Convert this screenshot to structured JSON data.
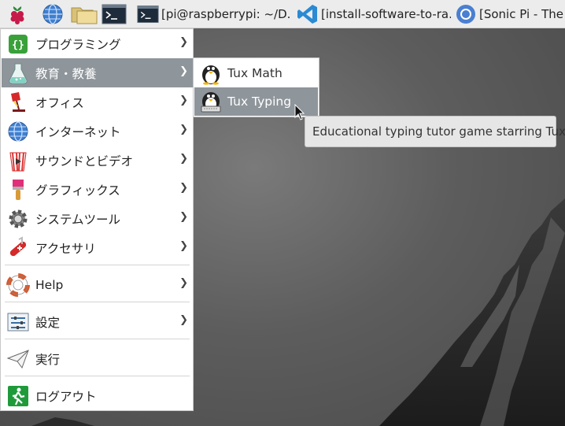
{
  "taskbar": {
    "tasks": [
      {
        "label": "[pi@raspberrypi: ~/D...",
        "icon": "terminal-icon"
      },
      {
        "label": "[install-software-to-ra...",
        "icon": "vscode-icon"
      },
      {
        "label": "[Sonic Pi - The L",
        "icon": "chromium-icon"
      }
    ]
  },
  "menu": {
    "items": [
      {
        "label": "プログラミング",
        "icon": "programming-icon"
      },
      {
        "label": "教育・教養",
        "icon": "education-flask-icon"
      },
      {
        "label": "オフィス",
        "icon": "office-lamp-icon"
      },
      {
        "label": "インターネット",
        "icon": "globe-icon"
      },
      {
        "label": "サウンドとビデオ",
        "icon": "popcorn-icon"
      },
      {
        "label": "グラフィックス",
        "icon": "paintbrush-icon"
      },
      {
        "label": "システムツール",
        "icon": "gear-icon"
      },
      {
        "label": "アクセサリ",
        "icon": "swiss-knife-icon"
      },
      {
        "label": "Help",
        "icon": "lifebuoy-icon"
      },
      {
        "label": "設定",
        "icon": "settings-sliders-icon"
      },
      {
        "label": "実行",
        "icon": "paper-plane-icon"
      },
      {
        "label": "ログアウト",
        "icon": "exit-icon"
      }
    ]
  },
  "submenu": {
    "items": [
      {
        "label": "Tux Math",
        "icon": "tux-math-icon"
      },
      {
        "label": "Tux Typing",
        "icon": "tux-typing-icon"
      }
    ]
  },
  "tooltip": "Educational typing tutor game starring Tux",
  "colors": {
    "highlight": "#8e959b",
    "taskbar": "#ececec",
    "menu_bg": "#ffffff"
  }
}
